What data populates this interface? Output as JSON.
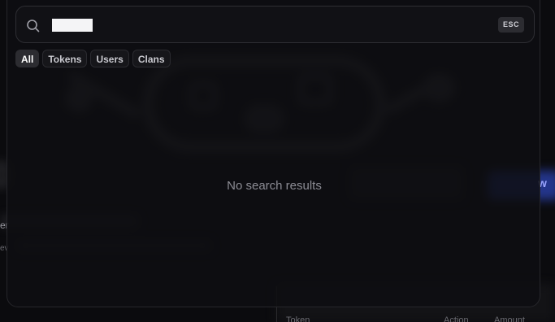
{
  "search": {
    "value": "",
    "esc_label": "ESC"
  },
  "tabs": [
    {
      "label": "All",
      "active": true
    },
    {
      "label": "Tokens",
      "active": false
    },
    {
      "label": "Users",
      "active": false
    },
    {
      "label": "Clans",
      "active": false
    }
  ],
  "results": {
    "empty_message": "No search results"
  },
  "background": {
    "edge_er": "er",
    "edge_ev": "ev",
    "edge_now": "w",
    "bottom_left": "Token",
    "bottom_mid": "Action",
    "bottom_right": "Amount"
  },
  "colors": {
    "accent_blue": "#273a9a",
    "modal_bg": "#0e0e12",
    "tab_active_bg": "#2c2c31"
  }
}
